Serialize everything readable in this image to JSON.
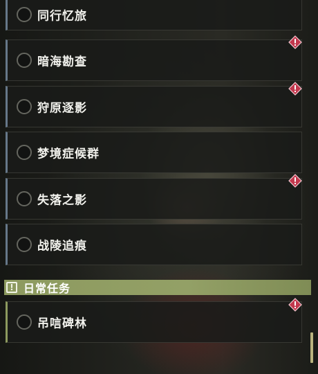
{
  "quests": [
    {
      "name": "同行忆旅",
      "alert": false
    },
    {
      "name": "暗海勘查",
      "alert": true
    },
    {
      "name": "狩原逐影",
      "alert": true
    },
    {
      "name": "梦境症候群",
      "alert": false
    },
    {
      "name": "失落之影",
      "alert": true
    },
    {
      "name": "战陵追痕",
      "alert": false
    }
  ],
  "daily_section": {
    "title": "日常任务",
    "icon": "exclamation-icon",
    "quests": [
      {
        "name": "吊唁碑林",
        "alert": true
      }
    ]
  },
  "colors": {
    "accent_olive": "#8d9a5f",
    "alert_red": "#c2384d",
    "quest_border_blue": "#66788a"
  }
}
